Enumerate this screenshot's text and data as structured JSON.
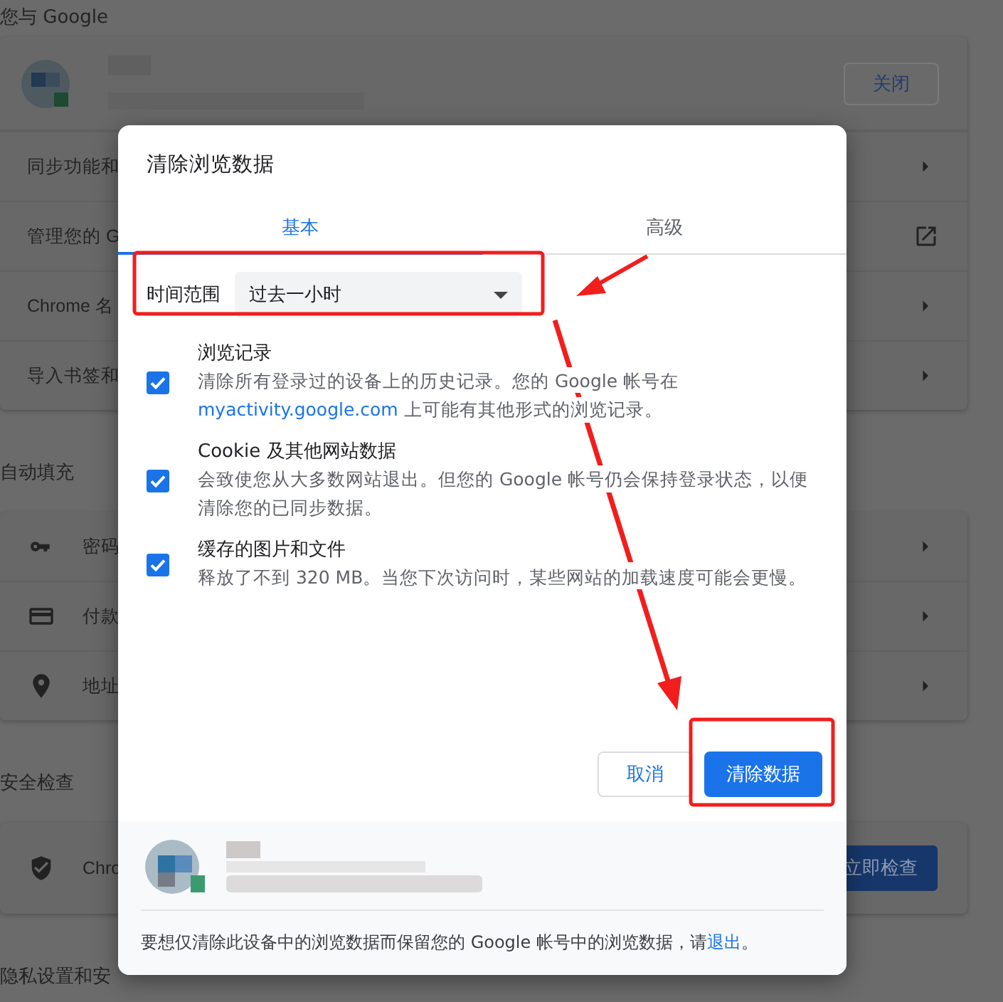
{
  "background": {
    "sections": [
      {
        "title": "您与 Google",
        "profile": {
          "button": "关闭"
        },
        "rows": [
          {
            "label": "同步功能和",
            "kind": "nav"
          },
          {
            "label": "管理您的 G",
            "kind": "external"
          },
          {
            "label": "Chrome 名",
            "kind": "nav"
          },
          {
            "label": "导入书签和",
            "kind": "nav"
          }
        ]
      },
      {
        "title": "自动填充",
        "rows": [
          {
            "label": "密码",
            "kind": "nav"
          },
          {
            "label": "付款",
            "kind": "nav"
          },
          {
            "label": "地址",
            "kind": "nav"
          }
        ]
      },
      {
        "title": "安全检查",
        "rows": [
          {
            "label": "Chro",
            "kind": "action",
            "button": "立即检查"
          }
        ]
      },
      {
        "title": "隐私设置和安"
      }
    ]
  },
  "dialog": {
    "title": "清除浏览数据",
    "tabs": [
      {
        "label": "基本",
        "selected": true
      },
      {
        "label": "高级",
        "selected": false
      }
    ],
    "time_range": {
      "label": "时间范围",
      "value": "过去一小时"
    },
    "items": [
      {
        "title": "浏览记录",
        "description": "清除所有登录过的设备上的历史记录。您的 Google 帐号在",
        "link": "myactivity.google.com",
        "description_end": " 上可能有其他形式的浏览记录。",
        "checked": true
      },
      {
        "title": "Cookie 及其他网站数据",
        "description": "会致使您从大多数网站退出。但您的 Google 帐号仍会保持登录状态，以便清除您的已同步数据。",
        "checked": true
      },
      {
        "title": "缓存的图片和文件",
        "description": "释放了不到 320 MB。当您下次访问时，某些网站的加载速度可能会更慢。",
        "checked": true
      }
    ],
    "buttons": [
      {
        "label": "取消",
        "kind": "secondary"
      },
      {
        "label": "清除数据",
        "kind": "primary"
      }
    ],
    "footer": {
      "note": "要想仅清除此设备中的浏览数据而保留您的 Google 帐号中的浏览数据，请",
      "link": "退出",
      "note_end": "。"
    }
  }
}
